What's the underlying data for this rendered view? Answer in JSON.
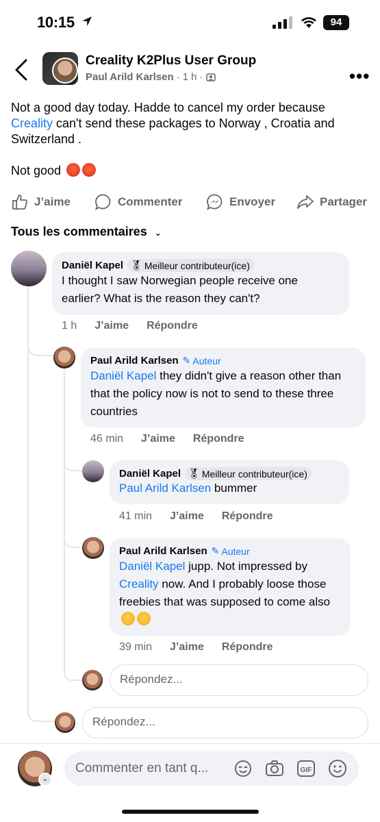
{
  "status_bar": {
    "time": "10:15",
    "battery": "94"
  },
  "header": {
    "group_name": "Creality K2Plus User Group",
    "author": "Paul Arild Karlsen",
    "time": "1 h"
  },
  "post": {
    "text_before_link": "Not a good day today. Hadde to cancel my order because ",
    "link": "Creality",
    "text_after_link": " can't send these packages to Norway , Croatia and Switzerland .",
    "text2": "Not good"
  },
  "actions": {
    "like": "J’aime",
    "comment": "Commenter",
    "send": "Envoyer",
    "share": "Partager"
  },
  "comments_header": "Tous les commentaires",
  "comments": [
    {
      "name": "Daniël Kapel",
      "badge": "Meilleur contributeur(ice)",
      "text": "I thought I saw Norwegian people receive one earlier? What is the reason they can't?",
      "time": "1 h",
      "like": "J’aime",
      "reply": "Répondre"
    },
    {
      "name": "Paul Arild Karlsen",
      "badge": "Auteur",
      "mention": "Daniël Kapel",
      "text": " they didn't give a reason other than that the policy now is not to send to these three countries",
      "time": "46 min",
      "like": "J’aime",
      "reply": "Répondre"
    },
    {
      "name": "Daniël Kapel",
      "badge": "Meilleur contributeur(ice)",
      "mention": "Paul Arild Karlsen",
      "text": " bummer",
      "time": "41 min",
      "like": "J’aime",
      "reply": "Répondre"
    },
    {
      "name": "Paul Arild Karlsen",
      "badge": "Auteur",
      "mention": "Daniël Kapel",
      "text_a": " jupp. Not impressed by ",
      "mention2": "Creality",
      "text_b": " now. And I probably loose those freebies that was supposed to come also",
      "time": "39 min",
      "like": "J’aime",
      "reply": "Répondre"
    }
  ],
  "reply_placeholder": "Répondez...",
  "composer_placeholder": "Commenter en tant q...",
  "colors": {
    "link": "#1877f2",
    "bubble": "#f0f2f5",
    "meta": "#65676b"
  }
}
